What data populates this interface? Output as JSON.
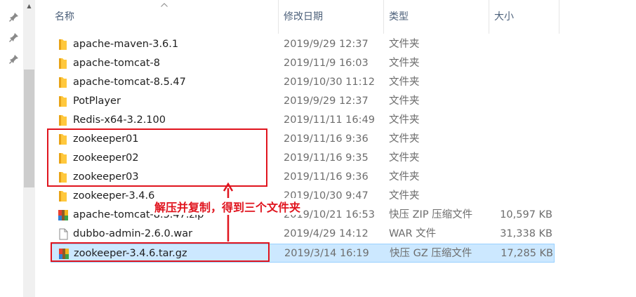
{
  "columns": {
    "name": "名称",
    "modified": "修改日期",
    "type": "类型",
    "size": "大小"
  },
  "rows": [
    {
      "name": "apache-maven-3.6.1",
      "modified": "2019/9/29 12:37",
      "type": "文件夹",
      "size": "",
      "icon": "folder-icon"
    },
    {
      "name": "apache-tomcat-8",
      "modified": "2019/11/9 16:03",
      "type": "文件夹",
      "size": "",
      "icon": "folder-icon"
    },
    {
      "name": "apache-tomcat-8.5.47",
      "modified": "2019/10/30 11:12",
      "type": "文件夹",
      "size": "",
      "icon": "folder-icon"
    },
    {
      "name": "PotPlayer",
      "modified": "2019/9/29 12:37",
      "type": "文件夹",
      "size": "",
      "icon": "folder-icon"
    },
    {
      "name": "Redis-x64-3.2.100",
      "modified": "2019/11/11 16:49",
      "type": "文件夹",
      "size": "",
      "icon": "folder-icon"
    },
    {
      "name": "zookeeper01",
      "modified": "2019/11/16 9:36",
      "type": "文件夹",
      "size": "",
      "icon": "folder-icon"
    },
    {
      "name": "zookeeper02",
      "modified": "2019/11/16 9:35",
      "type": "文件夹",
      "size": "",
      "icon": "folder-icon"
    },
    {
      "name": "zookeeper03",
      "modified": "2019/11/16 9:36",
      "type": "文件夹",
      "size": "",
      "icon": "folder-icon"
    },
    {
      "name": "zookeeper-3.4.6",
      "modified": "2019/10/30 9:47",
      "type": "文件夹",
      "size": "",
      "icon": "folder-icon"
    },
    {
      "name": "apache-tomcat-8.5.47.zip",
      "modified": "2019/10/21 16:53",
      "type": "快压 ZIP 压缩文件",
      "size": "10,597 KB",
      "icon": "archive-icon"
    },
    {
      "name": "dubbo-admin-2.6.0.war",
      "modified": "2019/4/29 14:12",
      "type": "WAR 文件",
      "size": "31,338 KB",
      "icon": "file-icon"
    },
    {
      "name": "zookeeper-3.4.6.tar.gz",
      "modified": "2019/3/14 16:19",
      "type": "快压 GZ 压缩文件",
      "size": "17,285 KB",
      "icon": "archive-icon"
    }
  ],
  "annotation": {
    "text": "解压并复制，得到三个文件夹",
    "color": "#e0141e"
  },
  "colors": {
    "folder": "#ffc83d",
    "selection": "#cce8ff",
    "header_text": "#4c607a"
  }
}
